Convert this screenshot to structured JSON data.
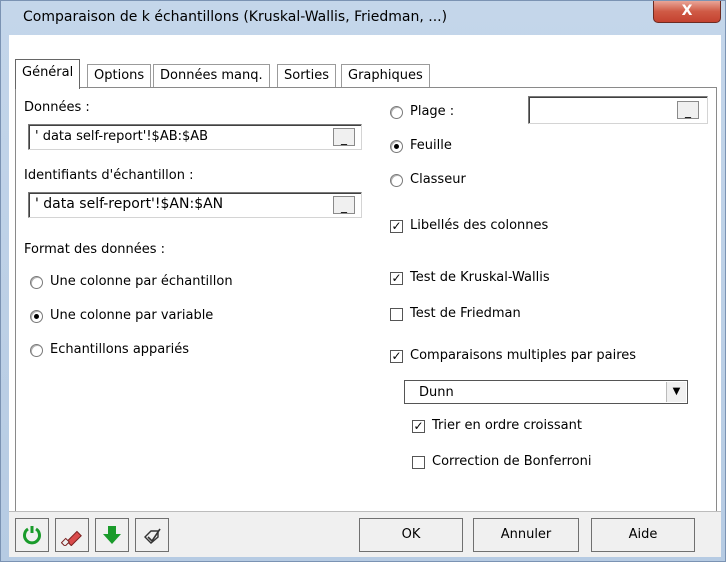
{
  "window": {
    "title": "Comparaison de k échantillons (Kruskal-Wallis, Friedman, ...)",
    "close_label": "X"
  },
  "tabs": [
    {
      "label": "Général",
      "active": true
    },
    {
      "label": "Options",
      "active": false
    },
    {
      "label": "Données manq.",
      "active": false
    },
    {
      "label": "Sorties",
      "active": false
    },
    {
      "label": "Graphiques",
      "active": false
    }
  ],
  "left": {
    "data_label": "Données :",
    "data_value": "' data self-report'!$AB:$AB",
    "ids_label": "Identifiants d'échantillon :",
    "ids_value": "' data self-report'!$AN:$AN",
    "button_dots": "_",
    "format_label": "Format des données :",
    "format_options": [
      {
        "label": "Une colonne par échantillon",
        "checked": false
      },
      {
        "label": "Une colonne par variable",
        "checked": true
      },
      {
        "label": "Echantillons appariés",
        "checked": false
      }
    ]
  },
  "right": {
    "range_label": "Plage :",
    "range_value": "",
    "sheet_label": "Feuille",
    "workbook_label": "Classeur",
    "column_labels": "Libellés des colonnes",
    "kruskal": "Test de Kruskal-Wallis",
    "friedman": "Test de Friedman",
    "multiple": "Comparaisons multiples par paires",
    "method_value": "Dunn",
    "sort_asc": "Trier en ordre croissant",
    "bonferroni": "Correction de Bonferroni",
    "checked": {
      "range": false,
      "sheet": true,
      "workbook": false,
      "column_labels": true,
      "kruskal": true,
      "friedman": false,
      "multiple": true,
      "sort_asc": true,
      "bonferroni": false
    }
  },
  "bottom": {
    "ok": "OK",
    "cancel": "Annuler",
    "help": "Aide",
    "icons": [
      "reset-icon",
      "eraser-icon",
      "down-arrow-icon",
      "clear-select-icon"
    ]
  },
  "colors": {
    "accent_green": "#1a9b2b",
    "close_red": "#c44230",
    "title_blue": "#b6cbe3"
  }
}
